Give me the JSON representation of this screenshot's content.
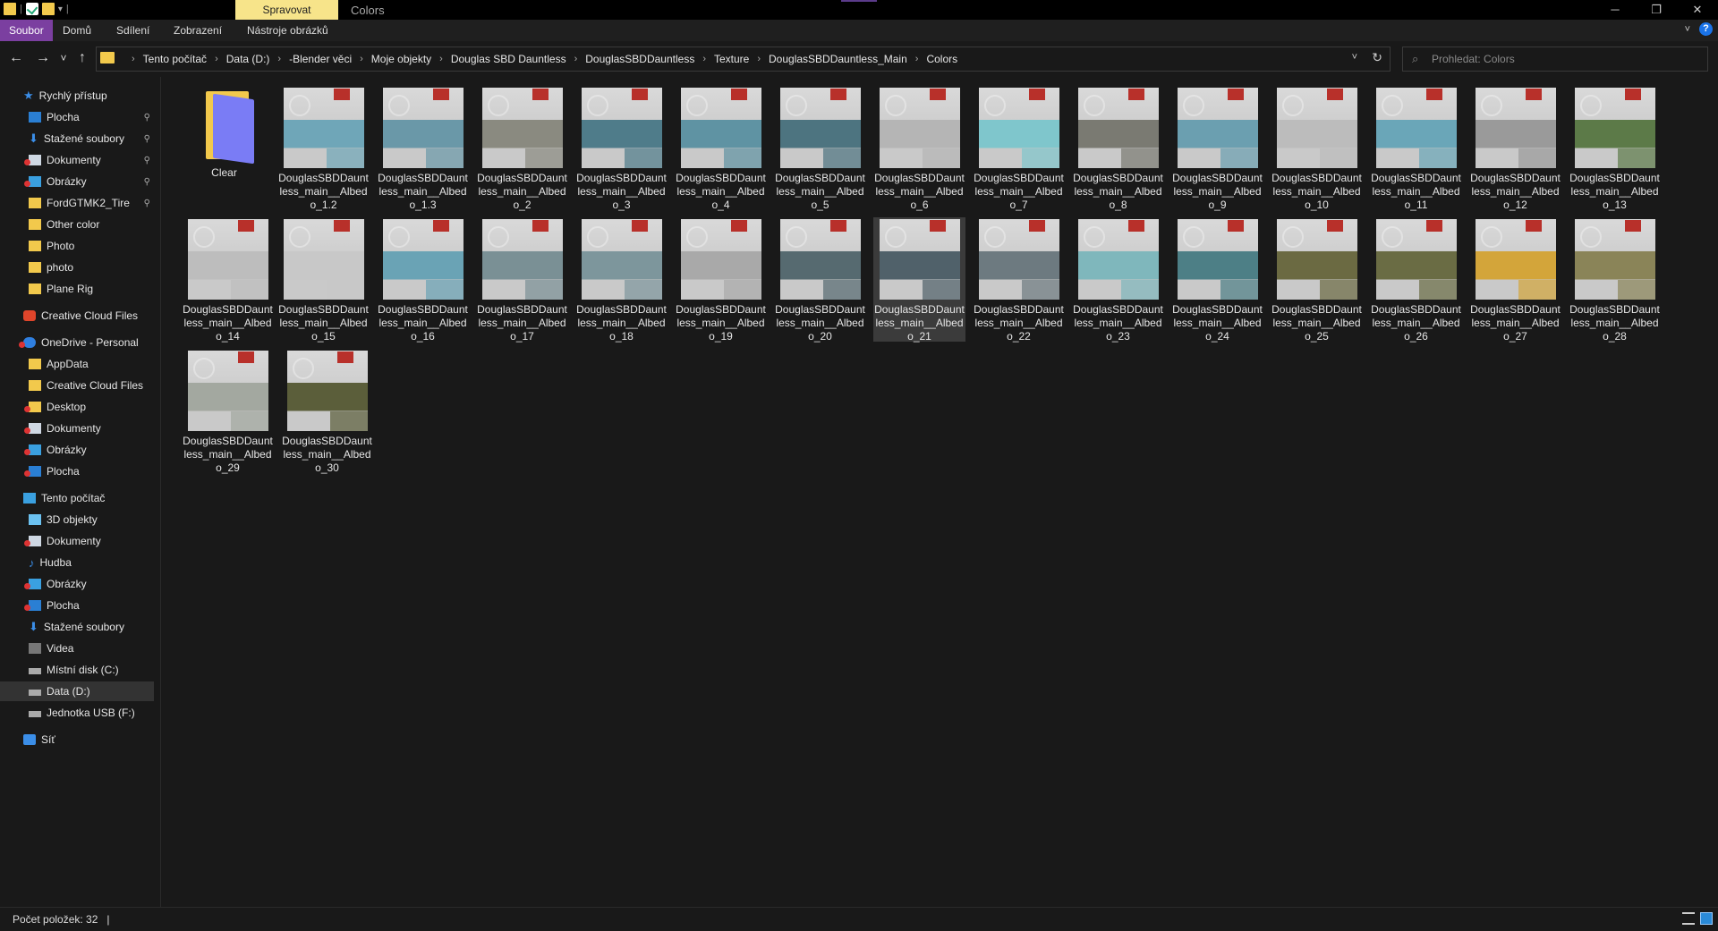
{
  "window": {
    "context_tab": "Spravovat",
    "title": "Colors",
    "controls": {
      "minimize": "─",
      "maximize": "❐",
      "close": "✕"
    }
  },
  "ribbon": {
    "tabs": [
      "Soubor",
      "Domů",
      "Sdílení",
      "Zobrazení",
      "Nástroje obrázků"
    ],
    "active": "Soubor",
    "file_tab_color": "#7b3fa0",
    "context_tab_color": "#f7e48a"
  },
  "navigation": {
    "back": "←",
    "forward": "→",
    "recent": "˅",
    "up": "↑",
    "breadcrumb": [
      "Tento počítač",
      "Data (D:)",
      "-Blender věci",
      "Moje objekty",
      "Douglas SBD Dauntless",
      "DouglasSBDDauntless",
      "Texture",
      "DouglasSBDDauntless_Main",
      "Colors"
    ],
    "search_placeholder": "Prohledat: Colors"
  },
  "sidebar": {
    "items": [
      {
        "label": "Rychlý přístup",
        "icon": "star-icon",
        "level": 0,
        "pinned": false
      },
      {
        "label": "Plocha",
        "icon": "desktop-icon",
        "level": 1,
        "pinned": true
      },
      {
        "label": "Stažené soubory",
        "icon": "download-icon",
        "level": 1,
        "pinned": true
      },
      {
        "label": "Dokumenty",
        "icon": "documents-icon",
        "level": 1,
        "pinned": true,
        "error": true
      },
      {
        "label": "Obrázky",
        "icon": "pictures-icon",
        "level": 1,
        "pinned": true,
        "error": true
      },
      {
        "label": "FordGTMK2_Tire",
        "icon": "folder-icon",
        "level": 1,
        "pinned": true
      },
      {
        "label": "Other color",
        "icon": "folder-icon",
        "level": 1,
        "pinned": false
      },
      {
        "label": "Photo",
        "icon": "folder-icon",
        "level": 1,
        "pinned": false
      },
      {
        "label": "photo",
        "icon": "folder-icon",
        "level": 1,
        "pinned": false
      },
      {
        "label": "Plane Rig",
        "icon": "folder-icon",
        "level": 1,
        "pinned": false
      },
      {
        "label": "Creative Cloud Files",
        "icon": "creative-cloud-icon",
        "level": 0,
        "pinned": false
      },
      {
        "label": "OneDrive - Personal",
        "icon": "onedrive-icon",
        "level": 0,
        "pinned": false,
        "error": true
      },
      {
        "label": "AppData",
        "icon": "folder-icon",
        "level": 1,
        "pinned": false
      },
      {
        "label": "Creative Cloud Files",
        "icon": "folder-icon",
        "level": 1,
        "pinned": false
      },
      {
        "label": "Desktop",
        "icon": "folder-icon",
        "level": 1,
        "pinned": false,
        "error": true
      },
      {
        "label": "Dokumenty",
        "icon": "documents-icon",
        "level": 1,
        "pinned": false,
        "error": true
      },
      {
        "label": "Obrázky",
        "icon": "pictures-icon",
        "level": 1,
        "pinned": false,
        "error": true
      },
      {
        "label": "Plocha",
        "icon": "desktop-icon",
        "level": 1,
        "pinned": false,
        "error": true
      },
      {
        "label": "Tento počítač",
        "icon": "computer-icon",
        "level": 0,
        "pinned": false
      },
      {
        "label": "3D objekty",
        "icon": "3d-objects-icon",
        "level": 1,
        "pinned": false
      },
      {
        "label": "Dokumenty",
        "icon": "documents-icon",
        "level": 1,
        "pinned": false,
        "error": true
      },
      {
        "label": "Hudba",
        "icon": "music-icon",
        "level": 1,
        "pinned": false
      },
      {
        "label": "Obrázky",
        "icon": "pictures-icon",
        "level": 1,
        "pinned": false,
        "error": true
      },
      {
        "label": "Plocha",
        "icon": "desktop-icon",
        "level": 1,
        "pinned": false,
        "error": true
      },
      {
        "label": "Stažené soubory",
        "icon": "download-icon",
        "level": 1,
        "pinned": false
      },
      {
        "label": "Videa",
        "icon": "videos-icon",
        "level": 1,
        "pinned": false
      },
      {
        "label": "Místní disk (C:)",
        "icon": "drive-icon",
        "level": 1,
        "pinned": false
      },
      {
        "label": "Data (D:)",
        "icon": "drive-icon",
        "level": 1,
        "pinned": false,
        "selected": true
      },
      {
        "label": "Jednotka USB (F:)",
        "icon": "usb-drive-icon",
        "level": 1,
        "pinned": false
      },
      {
        "label": "Síť",
        "icon": "network-icon",
        "level": 0,
        "pinned": false
      }
    ]
  },
  "files": [
    {
      "name": "Clear",
      "type": "folder"
    },
    {
      "name": "DouglasSBDDauntless_main__Albedo_1.2",
      "type": "image",
      "tint": "#6fa6b8"
    },
    {
      "name": "DouglasSBDDauntless_main__Albedo_1.3",
      "type": "image",
      "tint": "#6a98a8"
    },
    {
      "name": "DouglasSBDDauntless_main__Albedo_2",
      "type": "image",
      "tint": "#8a8a80"
    },
    {
      "name": "DouglasSBDDauntless_main__Albedo_3",
      "type": "image",
      "tint": "#4f7c8a"
    },
    {
      "name": "DouglasSBDDauntless_main__Albedo_4",
      "type": "image",
      "tint": "#5f93a3"
    },
    {
      "name": "DouglasSBDDauntless_main__Albedo_5",
      "type": "image",
      "tint": "#4d7480"
    },
    {
      "name": "DouglasSBDDauntless_main__Albedo_6",
      "type": "image",
      "tint": "#b5b5b5"
    },
    {
      "name": "DouglasSBDDauntless_main__Albedo_7",
      "type": "image",
      "tint": "#7fc6cc"
    },
    {
      "name": "DouglasSBDDauntless_main__Albedo_8",
      "type": "image",
      "tint": "#7a7a72"
    },
    {
      "name": "DouglasSBDDauntless_main__Albedo_9",
      "type": "image",
      "tint": "#6b9fb0"
    },
    {
      "name": "DouglasSBDDauntless_main__Albedo_10",
      "type": "image",
      "tint": "#bcbcbc"
    },
    {
      "name": "DouglasSBDDauntless_main__Albedo_11",
      "type": "image",
      "tint": "#6aa6b8"
    },
    {
      "name": "DouglasSBDDauntless_main__Albedo_12",
      "type": "image",
      "tint": "#9a9a9a"
    },
    {
      "name": "DouglasSBDDauntless_main__Albedo_13",
      "type": "image",
      "tint": "#5c7a48"
    },
    {
      "name": "DouglasSBDDauntless_main__Albedo_14",
      "type": "image",
      "tint": "#bdbdbd"
    },
    {
      "name": "DouglasSBDDauntless_main__Albedo_15",
      "type": "image",
      "tint": "#c8c8c8"
    },
    {
      "name": "DouglasSBDDauntless_main__Albedo_16",
      "type": "image",
      "tint": "#6aa3b5"
    },
    {
      "name": "DouglasSBDDauntless_main__Albedo_17",
      "type": "image",
      "tint": "#7a9095"
    },
    {
      "name": "DouglasSBDDauntless_main__Albedo_18",
      "type": "image",
      "tint": "#7d969c"
    },
    {
      "name": "DouglasSBDDauntless_main__Albedo_19",
      "type": "image",
      "tint": "#a9a9a9"
    },
    {
      "name": "DouglasSBDDauntless_main__Albedo_20",
      "type": "image",
      "tint": "#566a70"
    },
    {
      "name": "DouglasSBDDauntless_main__Albedo_21",
      "type": "image",
      "tint": "#50616a",
      "selected": true
    },
    {
      "name": "DouglasSBDDauntless_main__Albedo_22",
      "type": "image",
      "tint": "#6d7a80"
    },
    {
      "name": "DouglasSBDDauntless_main__Albedo_23",
      "type": "image",
      "tint": "#7fb7bc"
    },
    {
      "name": "DouglasSBDDauntless_main__Albedo_24",
      "type": "image",
      "tint": "#4d7f86"
    },
    {
      "name": "DouglasSBDDauntless_main__Albedo_25",
      "type": "image",
      "tint": "#6b6a42"
    },
    {
      "name": "DouglasSBDDauntless_main__Albedo_26",
      "type": "image",
      "tint": "#6a6c44"
    },
    {
      "name": "DouglasSBDDauntless_main__Albedo_27",
      "type": "image",
      "tint": "#d3a53a"
    },
    {
      "name": "DouglasSBDDauntless_main__Albedo_28",
      "type": "image",
      "tint": "#8a8458"
    },
    {
      "name": "DouglasSBDDauntless_main__Albedo_29",
      "type": "image",
      "tint": "#a3a8a0"
    },
    {
      "name": "DouglasSBDDauntless_main__Albedo_30",
      "type": "image",
      "tint": "#5b5e3a"
    }
  ],
  "status": {
    "item_count": "Počet položek: 32",
    "separator": "|"
  }
}
